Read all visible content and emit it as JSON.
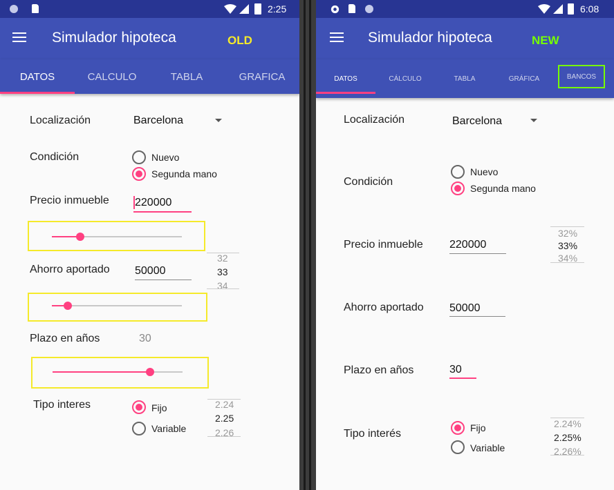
{
  "old": {
    "status": {
      "time": "2:25"
    },
    "appbar": {
      "title": "Simulador hipoteca",
      "tag": "OLD",
      "tag_color": "#f5ea2a"
    },
    "tabs": [
      "DATOS",
      "CALCULO",
      "TABLA",
      "GRAFICA"
    ],
    "form": {
      "location_label": "Localización",
      "location_value": "Barcelona",
      "condition_label": "Condición",
      "condition_options": [
        "Nuevo",
        "Segunda mano"
      ],
      "price_label": "Precio inmueble",
      "price_value": "220000",
      "price_slider_fraction": 0.22,
      "savings_label": "Ahorro aportado",
      "savings_value": "50000",
      "savings_picker": [
        "32",
        "33",
        "34"
      ],
      "savings_slider_fraction": 0.12,
      "term_label": "Plazo en años",
      "term_value": "30",
      "term_slider_fraction": 0.75,
      "interest_label": "Tipo interes",
      "interest_options": [
        "Fijo",
        "Variable"
      ],
      "interest_picker": [
        "2.24",
        "2.25",
        "2.26"
      ]
    }
  },
  "new": {
    "status": {
      "time": "6:08"
    },
    "appbar": {
      "title": "Simulador hipoteca",
      "tag": "NEW",
      "tag_color": "#76ff03"
    },
    "tabs": [
      "DATOS",
      "CÁLCULO",
      "TABLA",
      "GRÁFICA",
      "BANCOS"
    ],
    "form": {
      "location_label": "Localización",
      "location_value": "Barcelona",
      "condition_label": "Condición",
      "condition_options": [
        "Nuevo",
        "Segunda mano"
      ],
      "price_label": "Precio inmueble",
      "price_value": "220000",
      "price_picker": [
        "32%",
        "33%",
        "34%"
      ],
      "savings_label": "Ahorro aportado",
      "savings_value": "50000",
      "term_label": "Plazo en años",
      "term_value": "30",
      "interest_label": "Tipo interés",
      "interest_options": [
        "Fijo",
        "Variable"
      ],
      "interest_picker": [
        "2.24%",
        "2.25%",
        "2.26%"
      ]
    }
  },
  "colors": {
    "primary": "#3f51b5",
    "primary_dark": "#283593",
    "accent": "#ff4081",
    "highlight": "#f5ea2a"
  }
}
